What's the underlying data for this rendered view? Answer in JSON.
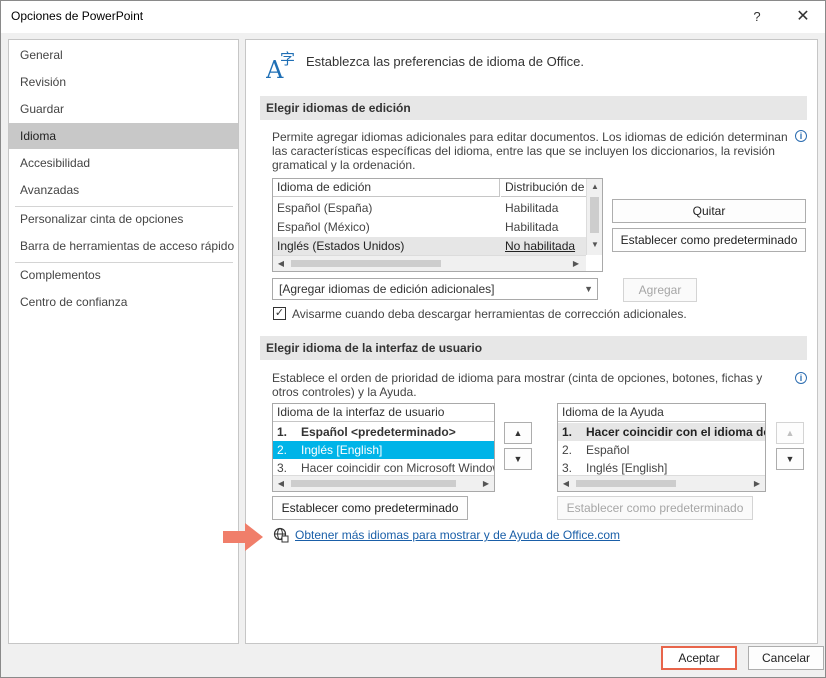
{
  "window": {
    "title": "Opciones de PowerPoint",
    "help_glyph": "?",
    "close_glyph": "✕"
  },
  "nav": {
    "items": [
      {
        "label": "General"
      },
      {
        "label": "Revisión"
      },
      {
        "label": "Guardar"
      },
      {
        "label": "Idioma",
        "selected": true
      },
      {
        "label": "Accesibilidad"
      },
      {
        "label": "Avanzadas"
      },
      {
        "label": "Personalizar cinta de opciones"
      },
      {
        "label": "Barra de herramientas de acceso rápido"
      },
      {
        "label": "Complementos"
      },
      {
        "label": "Centro de confianza"
      }
    ]
  },
  "header": {
    "title": "Establezca las preferencias de idioma de Office.",
    "icon": "language-icon"
  },
  "editing": {
    "title": "Elegir idiomas de edición",
    "description": "Permite agregar idiomas adicionales para editar documentos. Los idiomas de edición determinan las características específicas del idioma, entre las que se incluyen los diccionarios, la revisión gramatical y la ordenación.",
    "columns": [
      "Idioma de edición",
      "Distribución de"
    ],
    "rows": [
      {
        "language": "Español (España)",
        "status": "Habilitada"
      },
      {
        "language": "Español (México)",
        "status": "Habilitada"
      },
      {
        "language": "Inglés (Estados Unidos)",
        "status": "No habilitada"
      }
    ],
    "remove_button": "Quitar",
    "set_default_button": "Establecer como predeterminado",
    "add_dropdown_value": "[Agregar idiomas de edición adicionales]",
    "add_button": "Agregar",
    "notify_checkbox_label": "Avisarme cuando deba descargar herramientas de corrección adicionales.",
    "notify_checked": true
  },
  "ui_language": {
    "title": "Elegir idioma de la interfaz de usuario",
    "description": "Establece el orden de prioridad de idioma para mostrar (cinta de opciones, botones, fichas y otros controles) y la Ayuda.",
    "display_header": "Idioma de la interfaz de usuario",
    "display_rows": [
      {
        "num": "1.",
        "label": "Español <predeterminado>"
      },
      {
        "num": "2.",
        "label": "Inglés [English]"
      },
      {
        "num": "3.",
        "label": "Hacer coincidir con Microsoft Windows"
      }
    ],
    "help_header": "Idioma de la Ayuda",
    "help_rows": [
      {
        "num": "1.",
        "label": "Hacer coincidir con el idioma de"
      },
      {
        "num": "2.",
        "label": "Español"
      },
      {
        "num": "3.",
        "label": "Inglés [English]"
      }
    ],
    "display_set_default": "Establecer como predeterminado",
    "help_set_default": "Establecer como predeterminado",
    "more_link": "Obtener más idiomas para mostrar y de Ayuda de Office.com"
  },
  "footer": {
    "ok": "Aceptar",
    "cancel": "Cancelar"
  },
  "colors": {
    "selection": "#00b4e8",
    "accent_red": "#e8654b",
    "link": "#1a5fa8"
  }
}
